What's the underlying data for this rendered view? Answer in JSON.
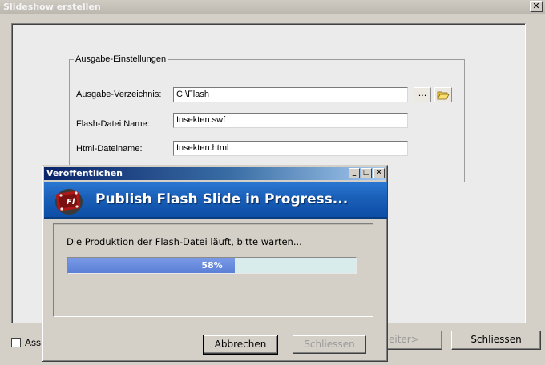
{
  "main_window": {
    "title": "Slideshow erstellen",
    "close_glyph": "✕",
    "group_label": "Ausgabe-Einstellungen",
    "fields": {
      "output_dir": {
        "label": "Ausgabe-Verzeichnis:",
        "value": "C:\\Flash"
      },
      "flash_name": {
        "label": "Flash-Datei Name:",
        "value": "Insekten.swf"
      },
      "html_name": {
        "label": "Html-Dateiname:",
        "value": "Insekten.html"
      }
    },
    "browse_label": "...",
    "folder_icon": "folder-open-icon",
    "checkbox_label": "Ass",
    "next_label": "eiter>",
    "close_label": "Schliessen"
  },
  "progress_dialog": {
    "title": "Veröffentlichen",
    "banner_text": "Publish Flash Slide in Progress...",
    "message": "Die Produktion der Flash-Datei läuft, bitte warten...",
    "progress": {
      "percent": 58,
      "label": "58%"
    },
    "cancel_label": "Abbrechen",
    "close_label": "Schliessen",
    "titlebar_buttons": {
      "minimize": "_",
      "maximize": "□",
      "close": "✕"
    }
  },
  "colors": {
    "progress_fill": "#5a7fd6",
    "progress_track": "#d8ecec",
    "banner_blue": "#1a5fb8"
  }
}
